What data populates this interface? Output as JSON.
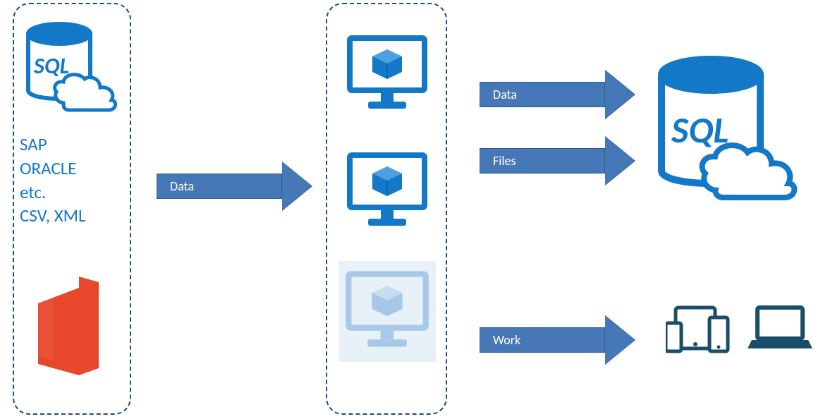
{
  "source": {
    "sql_label": "SQL",
    "list_line1": "SAP",
    "list_line2": "ORACLE",
    "list_line3": "etc.",
    "list_line4": "CSV, XML"
  },
  "arrows": {
    "left_data": "Data",
    "top_data": "Data",
    "files": "Files",
    "work": "Work"
  },
  "target": {
    "sql_label": "SQL"
  },
  "colors": {
    "azure_blue": "#1478c8",
    "arrow_fill": "#4678b8",
    "dark_navy": "#1a4d8a",
    "office_orange": "#e8472b"
  }
}
